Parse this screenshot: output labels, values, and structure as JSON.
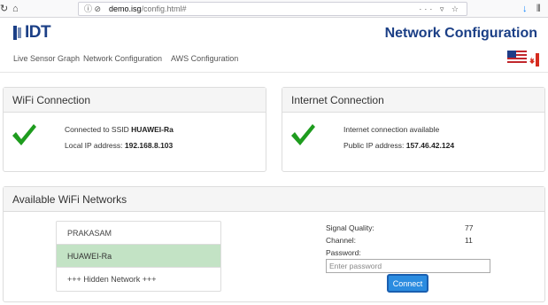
{
  "browser": {
    "url_host": "demo.isg",
    "url_path": "/config.html#"
  },
  "header": {
    "logo_text": "IDT",
    "title": "Network Configuration"
  },
  "nav": {
    "items": [
      {
        "label": "Live Sensor Graph"
      },
      {
        "label": "Network Configuration"
      },
      {
        "label": "AWS Configuration"
      }
    ]
  },
  "wifi": {
    "heading": "WiFi Connection",
    "line1_prefix": "Connected to SSID ",
    "ssid": "HUAWEI-Ra",
    "line2_prefix": "Local IP address: ",
    "local_ip": "192.168.8.103"
  },
  "internet": {
    "heading": "Internet Connection",
    "status": "Internet connection available",
    "line2_prefix": "Public IP address: ",
    "public_ip": "157.46.42.124"
  },
  "available": {
    "heading": "Available WiFi Networks",
    "networks": [
      {
        "label": "PRAKASAM"
      },
      {
        "label": "HUAWEI-Ra"
      },
      {
        "label": "+++ Hidden Network +++"
      }
    ],
    "signal_label": "Signal Quality:",
    "signal_value": "77",
    "channel_label": "Channel:",
    "channel_value": "11",
    "password_label": "Password:",
    "password_placeholder": "Enter password",
    "connect_label": "Connect"
  },
  "colors": {
    "brand": "#1b3f86",
    "check": "#1e9c1e",
    "selected_row": "#c3e3c5",
    "button": "#2b8ce0"
  }
}
